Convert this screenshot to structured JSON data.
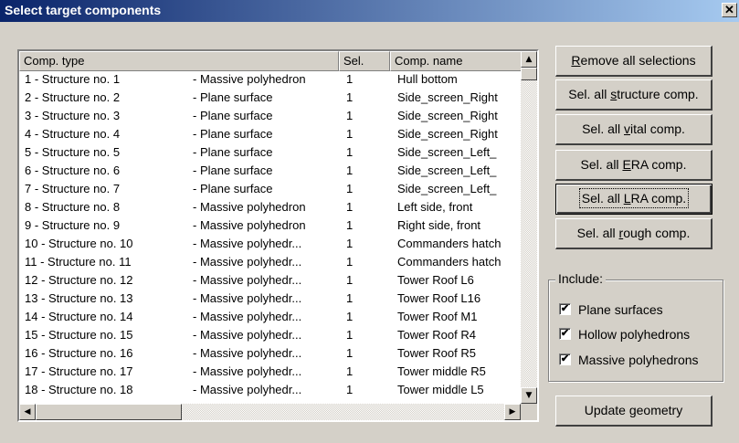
{
  "window": {
    "title": "Select target components",
    "close_glyph": "✕"
  },
  "table": {
    "columns": [
      "Comp. type",
      "Sel.",
      "Comp. name"
    ],
    "rows": [
      {
        "type": "1 - Structure no. 1",
        "shape": "- Massive polyhedron",
        "sel": "1",
        "name": "Hull bottom"
      },
      {
        "type": "2 - Structure no. 2",
        "shape": "- Plane surface",
        "sel": "1",
        "name": "Side_screen_Right"
      },
      {
        "type": "3 - Structure no. 3",
        "shape": "- Plane surface",
        "sel": "1",
        "name": "Side_screen_Right"
      },
      {
        "type": "4 - Structure no. 4",
        "shape": "- Plane surface",
        "sel": "1",
        "name": "Side_screen_Right"
      },
      {
        "type": "5 - Structure no. 5",
        "shape": "- Plane surface",
        "sel": "1",
        "name": "Side_screen_Left_"
      },
      {
        "type": "6 - Structure no. 6",
        "shape": "- Plane surface",
        "sel": "1",
        "name": "Side_screen_Left_"
      },
      {
        "type": "7 - Structure no. 7",
        "shape": "- Plane surface",
        "sel": "1",
        "name": "Side_screen_Left_"
      },
      {
        "type": "8 - Structure no. 8",
        "shape": "- Massive polyhedron",
        "sel": "1",
        "name": "Left side, front"
      },
      {
        "type": "9 - Structure no. 9",
        "shape": "- Massive polyhedron",
        "sel": "1",
        "name": "Right side, front"
      },
      {
        "type": "10 - Structure no. 10",
        "shape": "- Massive polyhedr...",
        "sel": "1",
        "name": "Commanders hatch"
      },
      {
        "type": "11 - Structure no. 11",
        "shape": "- Massive polyhedr...",
        "sel": "1",
        "name": "Commanders hatch"
      },
      {
        "type": "12 - Structure no. 12",
        "shape": "- Massive polyhedr...",
        "sel": "1",
        "name": "Tower Roof L6"
      },
      {
        "type": "13 - Structure no. 13",
        "shape": "- Massive polyhedr...",
        "sel": "1",
        "name": "Tower Roof L16"
      },
      {
        "type": "14 - Structure no. 14",
        "shape": "- Massive polyhedr...",
        "sel": "1",
        "name": "Tower Roof M1"
      },
      {
        "type": "15 - Structure no. 15",
        "shape": "- Massive polyhedr...",
        "sel": "1",
        "name": "Tower Roof R4"
      },
      {
        "type": "16 - Structure no. 16",
        "shape": "- Massive polyhedr...",
        "sel": "1",
        "name": "Tower Roof R5"
      },
      {
        "type": "17 - Structure no. 17",
        "shape": "- Massive polyhedr...",
        "sel": "1",
        "name": "Tower middle R5"
      },
      {
        "type": "18 - Structure no. 18",
        "shape": "- Massive polyhedr...",
        "sel": "1",
        "name": "Tower middle L5"
      }
    ]
  },
  "buttons": {
    "remove_all": {
      "pre": "",
      "key": "R",
      "post": "emove all selections"
    },
    "sel_structure": {
      "pre": "Sel. all ",
      "key": "s",
      "post": "tructure comp."
    },
    "sel_vital": {
      "pre": "Sel. all ",
      "key": "v",
      "post": "ital comp."
    },
    "sel_era": {
      "pre": "Sel. all ",
      "key": "E",
      "post": "RA comp."
    },
    "sel_lra": {
      "pre": "Sel. all ",
      "key": "L",
      "post": "RA comp."
    },
    "sel_rough": {
      "pre": "Sel. all ",
      "key": "r",
      "post": "ough comp."
    },
    "update": {
      "pre": "Update ",
      "key": "g",
      "post": "eometry"
    }
  },
  "include": {
    "label": "Include:",
    "items": [
      {
        "label": "Plane surfaces",
        "checked": true
      },
      {
        "label": "Hollow polyhedrons",
        "checked": true
      },
      {
        "label": "Massive polyhedrons",
        "checked": true
      }
    ],
    "check_glyph": "✔"
  },
  "scroll": {
    "up": "▲",
    "down": "▼",
    "left": "◀",
    "right": "▶"
  }
}
